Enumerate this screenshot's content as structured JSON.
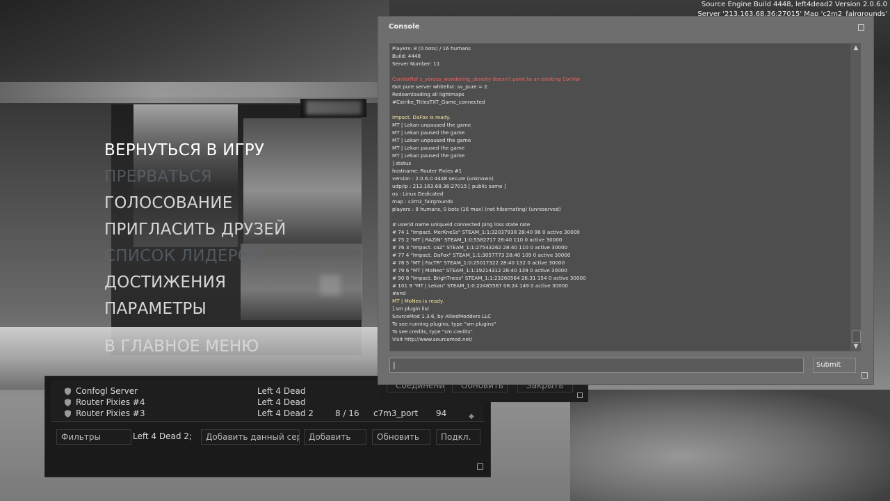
{
  "engine": {
    "build_line": "Source Engine Build 4448, left4dead2 Version 2.0.6.0",
    "server_line": "Server '213.163.68.36:27015' Map 'c2m2_fairgrounds'"
  },
  "menu": {
    "items": [
      {
        "label": "ВЕРНУТЬСЯ В ИГРУ",
        "state": "active"
      },
      {
        "label": "ПРЕРВАТЬСЯ",
        "state": "disabled"
      },
      {
        "label": "ГОЛОСОВАНИЕ",
        "state": "normal"
      },
      {
        "label": "ПРИГЛАСИТЬ ДРУЗЕЙ",
        "state": "normal"
      },
      {
        "label": "СПИСОК ЛИДЕРОВ",
        "state": "disabled"
      },
      {
        "label": "ДОСТИЖЕНИЯ",
        "state": "normal"
      },
      {
        "label": "ПАРАМЕТРЫ",
        "state": "normal"
      },
      {
        "label": "В ГЛАВНОЕ МЕНЮ",
        "state": "normal"
      }
    ]
  },
  "server_browser": {
    "rows": [
      {
        "name": "Confogl Server",
        "game": "Left 4 Dead 2",
        "players": "",
        "map": "",
        "ping": "",
        "icon": "shield-icon"
      },
      {
        "name": "Router Pixies #4",
        "game": "Left 4 Dead 2",
        "players": "",
        "map": "",
        "ping": "",
        "icon": "shield-icon"
      },
      {
        "name": "Router Pixies #3",
        "game": "Left 4 Dead 2",
        "players": "8 / 16",
        "map": "c7m3_port",
        "ping": "94",
        "icon": "shield-icon"
      }
    ],
    "filters_label": "Фильтры",
    "game_label": "Left 4 Dead 2;",
    "add_current_label": "Добавить данный сер...",
    "add_label": "Добавить",
    "refresh_label": "Обновить",
    "connect_label": "Подкл."
  },
  "back_dialog": {
    "connection_label": "Соединение",
    "refresh_label": "Обновить",
    "close_label": "Закрыть"
  },
  "console": {
    "title": "Console",
    "submit_label": "Submit",
    "input_value": "",
    "lines": [
      {
        "text": "Players: 8 (0 bots) / 16 humans",
        "color": "normal"
      },
      {
        "text": "Build: 4448",
        "color": "normal"
      },
      {
        "text": "Server Number: 11",
        "color": "normal"
      },
      {
        "text": "",
        "color": "blank"
      },
      {
        "text": "ConVarRef z_versus_wandering_density doesn't point to an existing ConVar",
        "color": "red"
      },
      {
        "text": "Got pure server whitelist: sv_pure = 2.",
        "color": "normal"
      },
      {
        "text": "Redownloading all lightmaps",
        "color": "normal"
      },
      {
        "text": "#Cstrike_TitlesTXT_Game_connected",
        "color": "normal"
      },
      {
        "text": "",
        "color": "blank"
      },
      {
        "text": "Impact. DaFox is ready.",
        "color": "yellow"
      },
      {
        "text": "MT | Lekan unpaused the game",
        "color": "normal"
      },
      {
        "text": "MT | Lekan paused the game",
        "color": "normal"
      },
      {
        "text": "MT | Lekan unpaused the game",
        "color": "normal"
      },
      {
        "text": "MT | Lekan paused the game",
        "color": "normal"
      },
      {
        "text": "MT | Lekan paused the game",
        "color": "normal"
      },
      {
        "text": "] status",
        "color": "normal"
      },
      {
        "text": "hostname: Router Pixies #1",
        "color": "normal"
      },
      {
        "text": "version : 2.0.6.0 4448 secure  (unknown)",
        "color": "normal"
      },
      {
        "text": "udp/ip  : 213.163.68.36:27015 [ public same ]",
        "color": "normal"
      },
      {
        "text": "os      : Linux Dedicated",
        "color": "normal"
      },
      {
        "text": "map     : c2m2_fairgrounds",
        "color": "normal"
      },
      {
        "text": "players : 8 humans, 0 bots (16 max) (not hibernating) (unreserved)",
        "color": "normal"
      },
      {
        "text": "",
        "color": "blank"
      },
      {
        "text": "# userid name uniqueid connected ping loss state rate",
        "color": "normal"
      },
      {
        "text": "# 74 1 \"Impact. MerKneSs\" STEAM_1:1:32037938 28:40 98 0 active 30000",
        "color": "normal"
      },
      {
        "text": "# 75 2 \"MT | RAZiN\" STEAM_1:0:5582717 28:40 110 0 active 30000",
        "color": "normal"
      },
      {
        "text": "# 76 3 \"Impact. caZ\" STEAM_1:1:27543262 28:40 110 0 active 30000",
        "color": "normal"
      },
      {
        "text": "# 77 4 \"Impact. DaFox\" STEAM_1:1:3057773 28:40 109 0 active 30000",
        "color": "normal"
      },
      {
        "text": "# 78 5 \"MT | FacTR\" STEAM_1:0:25017322 28:40 132 0 active 30000",
        "color": "normal"
      },
      {
        "text": "# 79 6 \"MT | MoNeo\" STEAM_1:1:19214312 28:40 139 0 active 30000",
        "color": "normal"
      },
      {
        "text": "# 90 8 \"Impact. BrighTness\" STEAM_1:1:23260564 26:31 154 0 active 30000",
        "color": "normal"
      },
      {
        "text": "# 101 9 \"MT | Lekan\" STEAM_1:0:22485567 08:24 149 0 active 30000",
        "color": "normal"
      },
      {
        "text": "#end",
        "color": "normal"
      },
      {
        "text": "MT | MoNeo is ready.",
        "color": "yellow"
      },
      {
        "text": "] sm plugin list",
        "color": "normal"
      },
      {
        "text": "SourceMod 1.3.6, by AlliedModders LLC",
        "color": "normal"
      },
      {
        "text": "To see running plugins, type \"sm plugins\"",
        "color": "normal"
      },
      {
        "text": "To see credits, type \"sm credits\"",
        "color": "normal"
      },
      {
        "text": "Visit http://www.sourcemod.net/",
        "color": "normal"
      }
    ]
  }
}
